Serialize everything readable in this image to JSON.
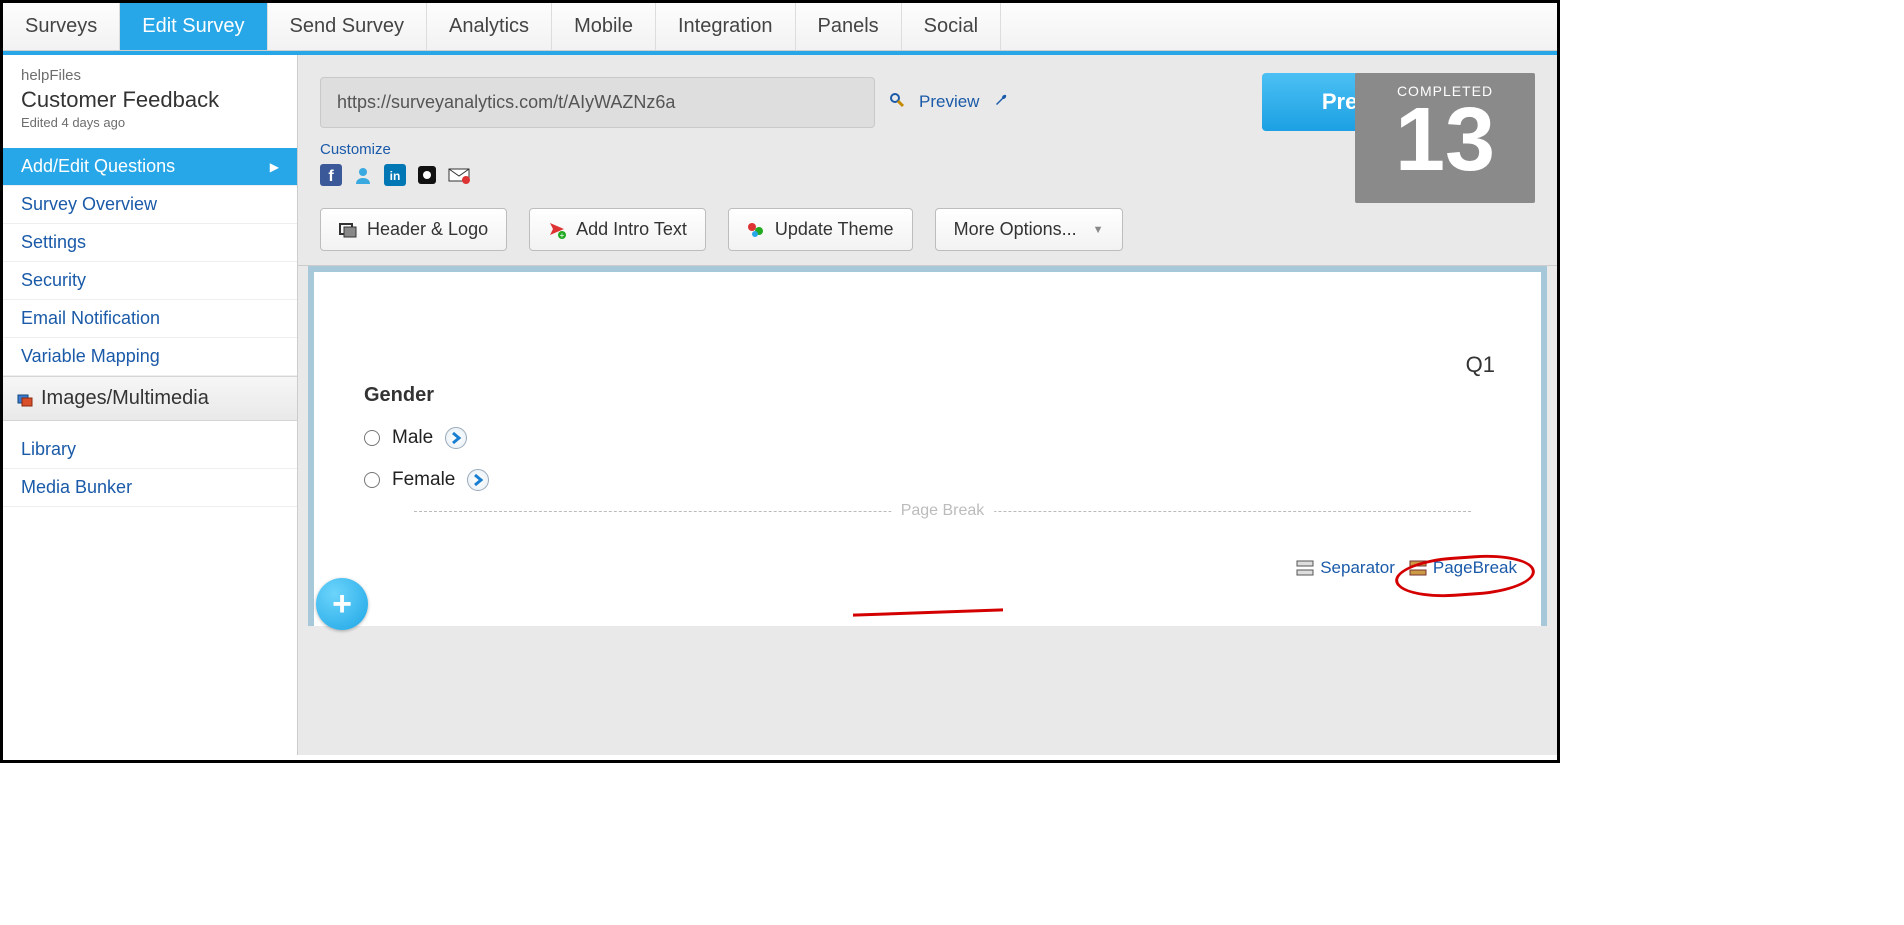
{
  "topnav": {
    "tabs": [
      "Surveys",
      "Edit Survey",
      "Send Survey",
      "Analytics",
      "Mobile",
      "Integration",
      "Panels",
      "Social"
    ],
    "active_index": 1
  },
  "sidebar": {
    "breadcrumb": "helpFiles",
    "title": "Customer Feedback",
    "edited": "Edited 4 days ago",
    "items": [
      {
        "label": "Add/Edit Questions",
        "active": true,
        "has_caret": true
      },
      {
        "label": "Survey Overview"
      },
      {
        "label": "Settings"
      },
      {
        "label": "Security"
      },
      {
        "label": "Email Notification"
      },
      {
        "label": "Variable Mapping"
      }
    ],
    "section_header": "Images/Multimedia",
    "sub_items": [
      {
        "label": "Library"
      },
      {
        "label": "Media Bunker"
      }
    ]
  },
  "toolbar": {
    "url": "https://surveyanalytics.com/t/AIyWAZNz6a",
    "preview_link": "Preview",
    "big_preview": "Preview",
    "customize": "Customize",
    "social_icons": [
      "facebook-icon",
      "person-icon",
      "linkedin-icon",
      "square-icon",
      "mail-icon"
    ],
    "buttons": {
      "header_logo": "Header & Logo",
      "add_intro": "Add Intro Text",
      "update_theme": "Update Theme",
      "more_options": "More Options..."
    },
    "completed": {
      "label": "COMPLETED",
      "count": "13"
    }
  },
  "question": {
    "number": "Q1",
    "title": "Gender",
    "options": [
      "Male",
      "Female"
    ],
    "actions": {
      "separator": "Separator",
      "pagebreak": "PageBreak"
    }
  },
  "pagebreak": {
    "label": "Page Break"
  },
  "add_button": "+"
}
